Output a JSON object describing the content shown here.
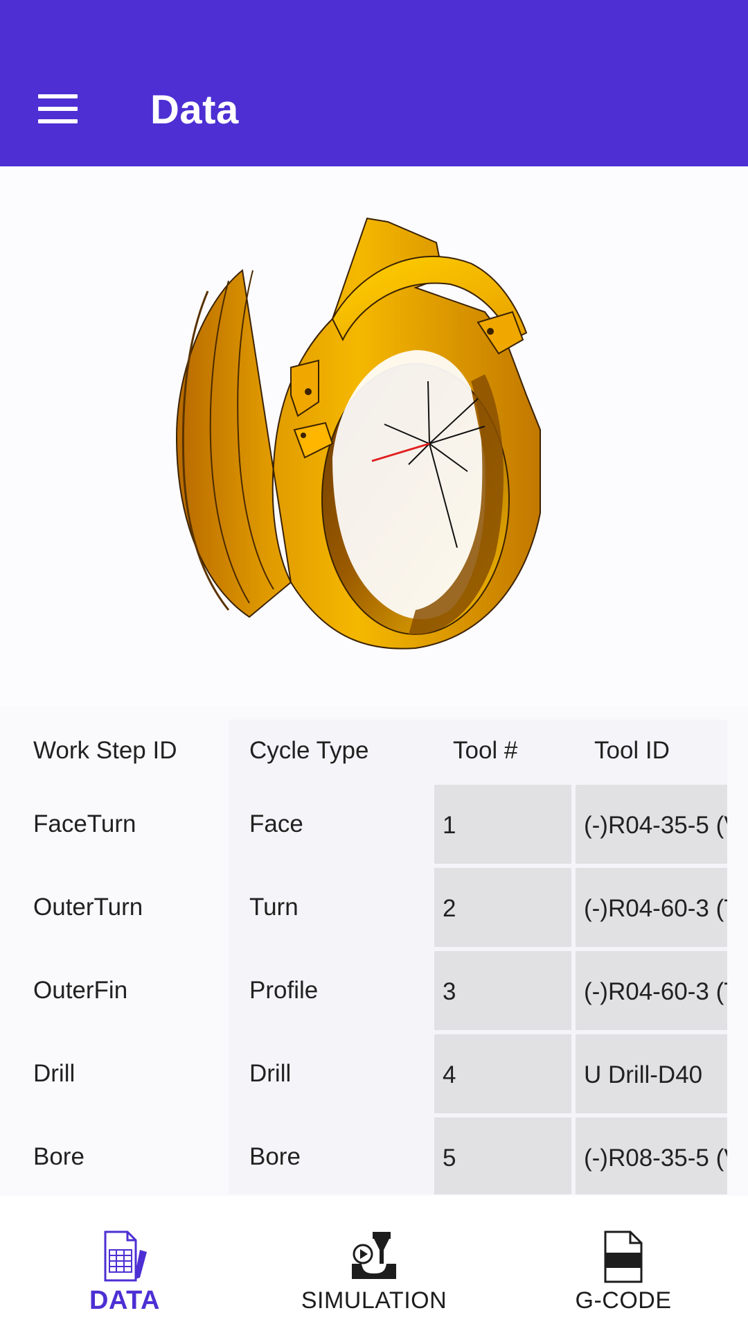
{
  "appbar": {
    "title": "Data",
    "menu_icon": "hamburger-menu-icon",
    "color": "#4d2fd3"
  },
  "viewer": {
    "part_color": "#f0a800"
  },
  "table": {
    "headers": {
      "work_step_id": "Work Step ID",
      "cycle_type": "Cycle Type",
      "tool_num": "Tool #",
      "tool_id": "Tool ID"
    },
    "rows": [
      {
        "work_step_id": "FaceTurn",
        "cycle_type": "Face",
        "tool_num": "1",
        "tool_id": "(-)R04-35-5 (V"
      },
      {
        "work_step_id": "OuterTurn",
        "cycle_type": "Turn",
        "tool_num": "2",
        "tool_id": "(-)R04-60-3 (T"
      },
      {
        "work_step_id": "OuterFin",
        "cycle_type": "Profile",
        "tool_num": "3",
        "tool_id": "(-)R04-60-3 (T"
      },
      {
        "work_step_id": "Drill",
        "cycle_type": "Drill",
        "tool_num": "4",
        "tool_id": "U Drill-D40"
      },
      {
        "work_step_id": "Bore",
        "cycle_type": "Bore",
        "tool_num": "5",
        "tool_id": "(-)R08-35-5 (V"
      }
    ]
  },
  "bottom_nav": {
    "items": [
      {
        "label": "DATA",
        "icon": "spreadsheet-pencil-icon",
        "active": true
      },
      {
        "label": "SIMULATION",
        "icon": "machining-simulation-icon",
        "active": false
      },
      {
        "label": "G-CODE",
        "icon": "gcode-file-icon",
        "active": false
      }
    ],
    "active_color": "#4d2fd3"
  }
}
